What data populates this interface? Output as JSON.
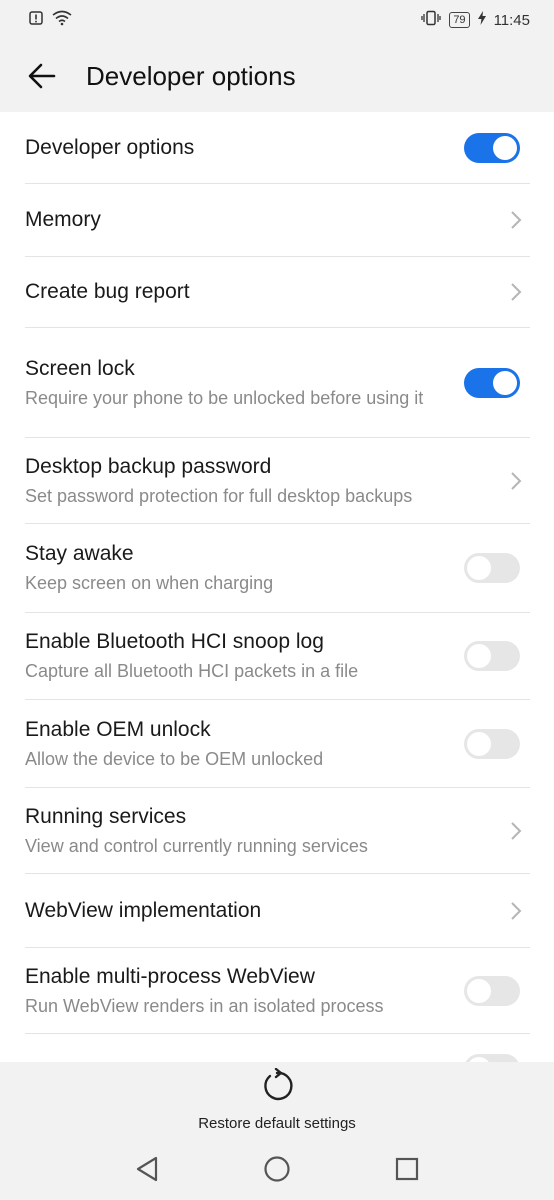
{
  "status_bar": {
    "time": "11:45",
    "battery": "79"
  },
  "app_bar": {
    "title": "Developer options"
  },
  "settings": [
    {
      "label": "Developer options",
      "control": "toggle",
      "checked": true
    },
    {
      "label": "Memory",
      "control": "chevron"
    },
    {
      "label": "Create bug report",
      "control": "chevron"
    },
    {
      "label": "Screen lock",
      "sub": "Require your phone to be unlocked before using it",
      "control": "toggle",
      "checked": true
    },
    {
      "label": "Desktop backup password",
      "sub": "Set password protection for full desktop backups",
      "control": "chevron"
    },
    {
      "label": "Stay awake",
      "sub": "Keep screen on when charging",
      "control": "toggle",
      "checked": false
    },
    {
      "label": "Enable Bluetooth HCI snoop log",
      "sub": "Capture all Bluetooth HCI packets in a file",
      "control": "toggle",
      "checked": false
    },
    {
      "label": "Enable OEM unlock",
      "sub": "Allow the device to be OEM unlocked",
      "control": "toggle",
      "checked": false
    },
    {
      "label": "Running services",
      "sub": "View and control currently running services",
      "control": "chevron"
    },
    {
      "label": "WebView implementation",
      "control": "chevron"
    },
    {
      "label": "Enable multi-process WebView",
      "sub": "Run WebView renders in an isolated process",
      "control": "toggle",
      "checked": false
    }
  ],
  "bottom_action": {
    "label": "Restore default settings",
    "icon": "restore-icon"
  },
  "colors": {
    "accent": "#1a73e8",
    "background": "#f2f2f2"
  }
}
